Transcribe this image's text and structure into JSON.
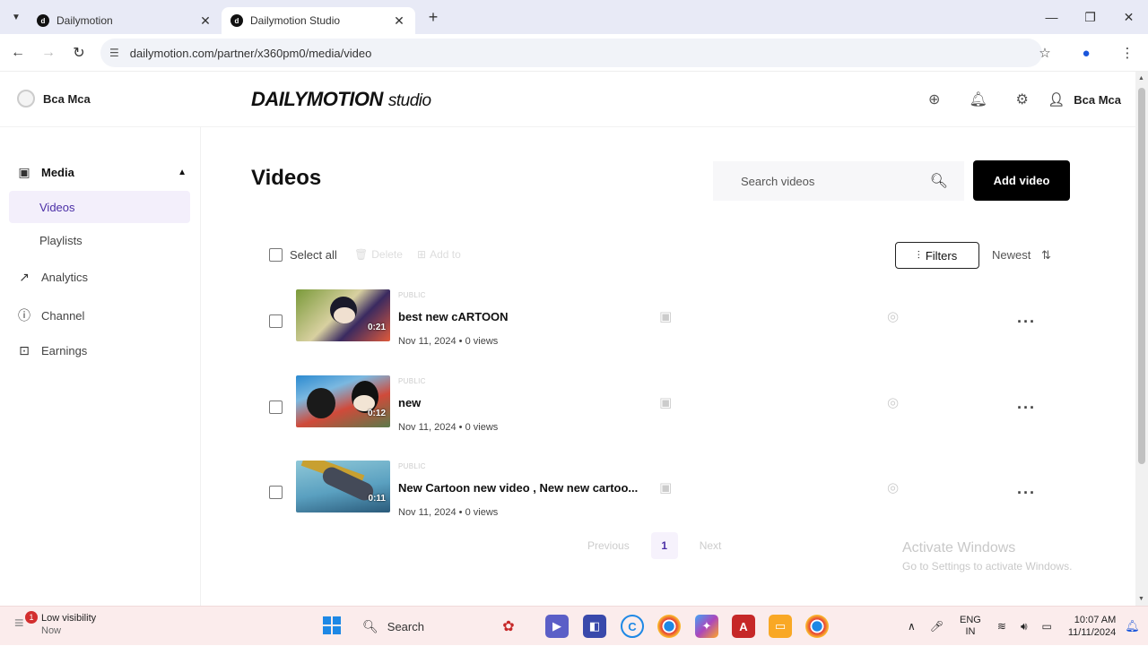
{
  "browser": {
    "tabs": [
      {
        "label": "Dailymotion",
        "active": false
      },
      {
        "label": "Dailymotion Studio",
        "active": true
      }
    ],
    "url": "dailymotion.com/partner/x360pm0/media/video"
  },
  "header": {
    "user_left": "Bca Mca",
    "logo_main": "DAILYMOTION",
    "logo_sub": "studio",
    "user_right": "Bca Mca"
  },
  "sidebar": {
    "media": "Media",
    "videos": "Videos",
    "playlists": "Playlists",
    "analytics": "Analytics",
    "channel": "Channel",
    "earnings": "Earnings"
  },
  "main": {
    "title": "Videos",
    "search_placeholder": "Search videos",
    "add_video": "Add video",
    "select_all": "Select all",
    "delete": "Delete",
    "add_to": "Add to",
    "filters": "Filters",
    "sort": "Newest"
  },
  "videos": [
    {
      "visibility": "PUBLIC",
      "title": "best new cARTOON",
      "meta": "Nov 11, 2024 • 0 views",
      "duration": "0:21"
    },
    {
      "visibility": "PUBLIC",
      "title": "new",
      "meta": "Nov 11, 2024 • 0 views",
      "duration": "0:12"
    },
    {
      "visibility": "PUBLIC",
      "title": "New Cartoon new video , New new cartoo...",
      "meta": "Nov 11, 2024 • 0 views",
      "duration": "0:11"
    }
  ],
  "pagination": {
    "previous": "Previous",
    "current": "1",
    "next": "Next"
  },
  "watermark": {
    "line1": "Activate Windows",
    "line2": "Go to Settings to activate Windows."
  },
  "taskbar": {
    "notif_count": "1",
    "notif_title": "Low visibility",
    "notif_sub": "Now",
    "search": "Search",
    "lang1": "ENG",
    "lang2": "IN",
    "time": "10:07 AM",
    "date": "11/11/2024"
  },
  "colors": {
    "accent": "#4b2fa6",
    "primary_button": "#000000",
    "taskbar": "#fbecec"
  }
}
